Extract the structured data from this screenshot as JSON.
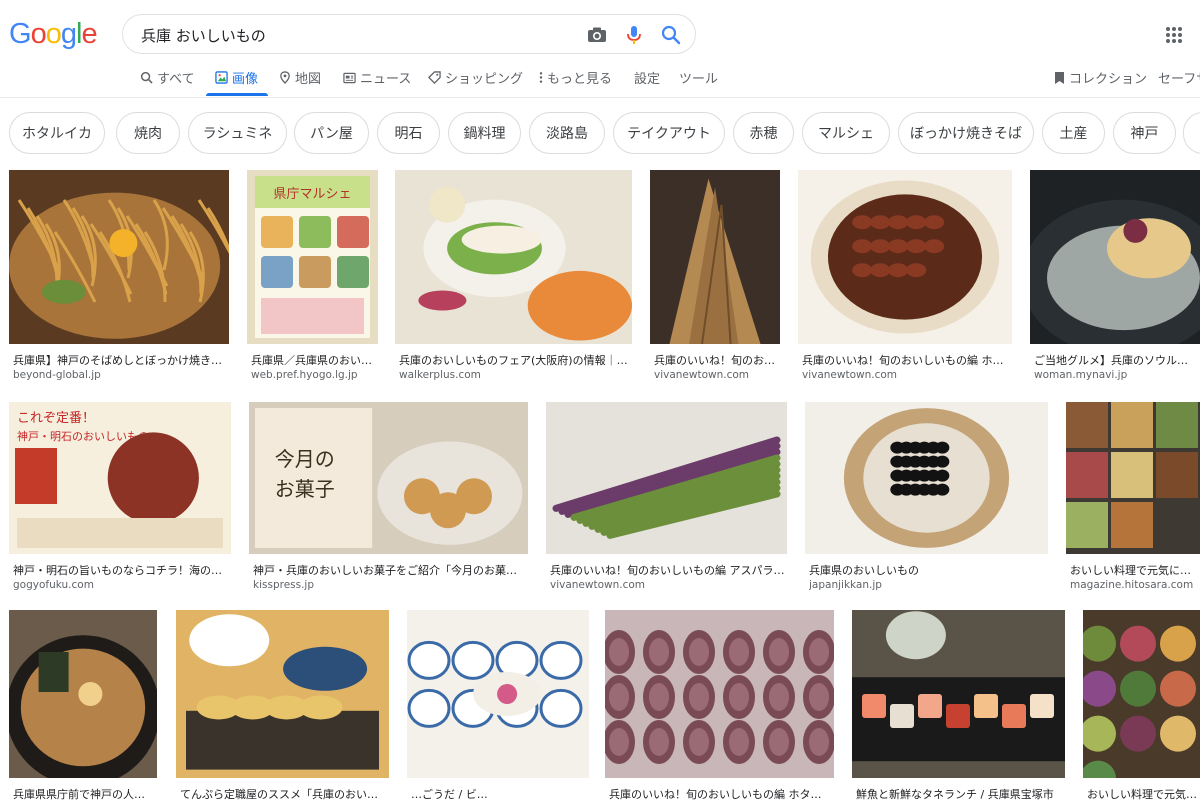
{
  "brand": {
    "logo_letters": [
      "G",
      "o",
      "o",
      "g",
      "l",
      "e"
    ],
    "logo_colors": [
      "#4285f4",
      "#ea4335",
      "#fbbc05",
      "#4285f4",
      "#34a853",
      "#ea4335"
    ]
  },
  "search": {
    "query": "兵庫 おいしいもの"
  },
  "tabs": [
    {
      "label": "すべて",
      "icon": "search-icon"
    },
    {
      "label": "画像",
      "icon": "image-icon",
      "active": true
    },
    {
      "label": "地図",
      "icon": "map-pin-icon"
    },
    {
      "label": "ニュース",
      "icon": "news-icon"
    },
    {
      "label": "ショッピング",
      "icon": "tag-icon"
    },
    {
      "label": "もっと見る",
      "icon": "more-vert-icon"
    },
    {
      "label": "設定"
    },
    {
      "label": "ツール"
    },
    {
      "label": "コレクション",
      "icon": "bookmark-icon"
    },
    {
      "label": "セーフサ"
    }
  ],
  "chips": [
    "ホタルイカ",
    "焼肉",
    "ラシュミネ",
    "パン屋",
    "明石",
    "鍋料理",
    "淡路島",
    "テイクアウト",
    "赤穂",
    "マルシェ",
    "ぼっかけ焼きそば",
    "土産",
    "神戸"
  ],
  "results": [
    {
      "title": "兵庫県】神戸のそばめしとぼっかけ焼き…",
      "site": "beyond-global.jp",
      "desc": "ぼっかけ焼きそば"
    },
    {
      "title": "兵庫県／兵庫県のおい…",
      "site": "web.pref.hyogo.lg.jp",
      "desc": "県庁マルシェ チラシ"
    },
    {
      "title": "兵庫のおいしいものフェア(大阪府)の情報｜…",
      "site": "walkerplus.com",
      "desc": "料理の盛り合わせ"
    },
    {
      "title": "兵庫のいいね！旬のお…",
      "site": "vivanewtown.com",
      "desc": "たけのこ"
    },
    {
      "title": "兵庫のいいね！旬のおいしいもの編 ホ…",
      "site": "vivanewtown.com",
      "desc": "ホタルイカ"
    },
    {
      "title": "ご当地グルメ】兵庫のソウルフード",
      "site": "woman.mynavi.jp",
      "desc": "明石焼き"
    },
    {
      "title": "神戸・明石の旨いものならコチラ！海の…",
      "site": "gogyofuku.com",
      "desc": "明石だこ"
    },
    {
      "title": "神戸・兵庫のおいしいお菓子をご紹介「今月のお菓子…",
      "site": "kisspress.jp",
      "desc": "今月のお菓子"
    },
    {
      "title": "兵庫のいいね！旬のおいしいもの編 アスパラ…",
      "site": "vivanewtown.com",
      "desc": "アスパラガス"
    },
    {
      "title": "兵庫県のおいしいもの",
      "site": "japanjikkan.jp",
      "desc": "黒豆"
    },
    {
      "title": "おいしい料理で元気に！ 兵",
      "site": "magazine.hitosara.com",
      "desc": "肉料理"
    },
    {
      "title": "兵庫県県庁前で神戸の人な…",
      "site": "",
      "desc": "ラーメン"
    },
    {
      "title": "てんぷら定職屋のススメ「兵庫のおいし…",
      "site": "",
      "desc": "天ぷら定食"
    },
    {
      "title": "…ごうだ / ビ…",
      "site": "",
      "desc": "和食膳"
    },
    {
      "title": "兵庫のいいね！旬のおいしいもの編 ホタル…",
      "site": "",
      "desc": "ホタルイカ"
    },
    {
      "title": "鮮魚と新鮮なタネランチ / 兵庫県宝塚市",
      "site": "",
      "desc": "刺身"
    },
    {
      "title": "おいしい料理で元気に！",
      "site": "",
      "desc": "前菜"
    }
  ],
  "poster_text": {
    "p2_title": "県庁マルシェ",
    "p7_title": "これぞ定番！",
    "p7_sub": "神戸・明石のおいしいもの",
    "p8_title1": "今月の",
    "p8_title2": "お菓子"
  }
}
